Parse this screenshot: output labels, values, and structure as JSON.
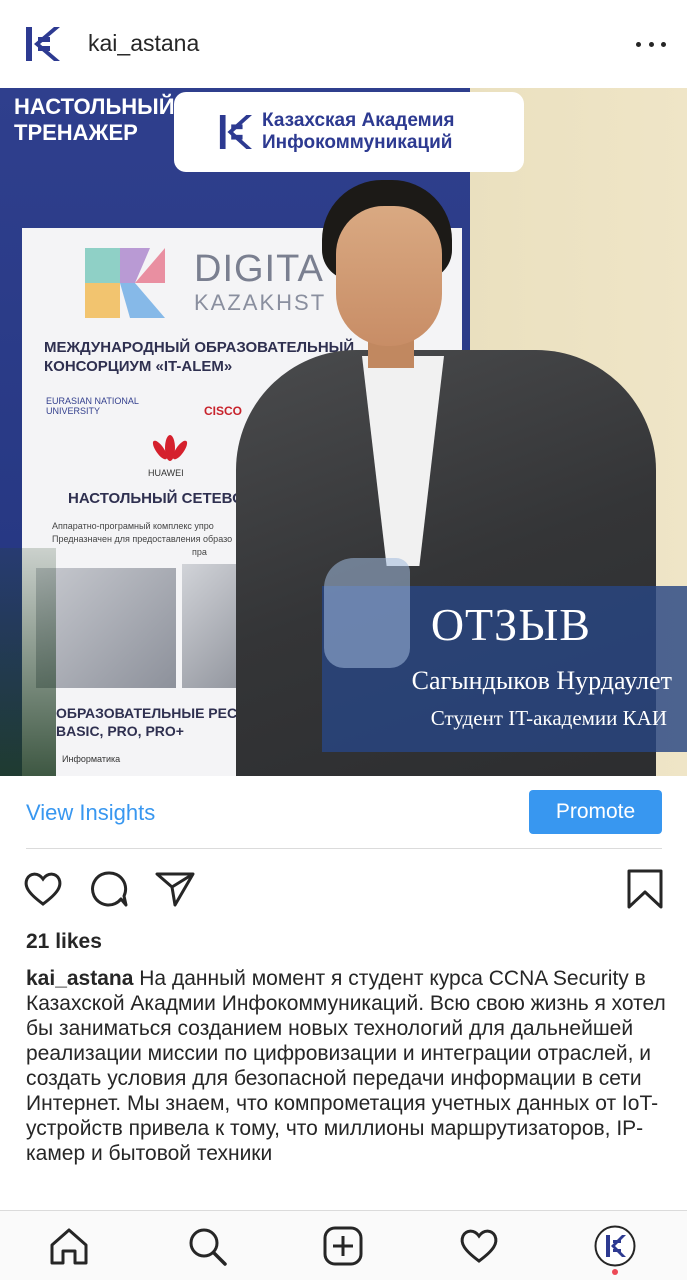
{
  "header": {
    "username": "kai_astana",
    "avatar_icon": "kai-logo-icon",
    "more_icon": "more-horizontal-icon"
  },
  "photo": {
    "banner_text": "НАСТОЛЬНЫЙ ТРЕНАЖЕР",
    "kai_badge_line1": "Казахская Академия",
    "kai_badge_line2": "Инфокоммуникаций",
    "poster": {
      "brand": "DIGITA",
      "brand_sub": "KAZAKHST",
      "heading1": "МЕЖДУНАРОДНЫЙ ОБРАЗОВАТЕЛЬНЫЙ КОНСОРЦИУМ «IT-ALEM»",
      "enu": "EURASIAN NATIONAL UNIVERSITY",
      "cisco": "CISCO",
      "huawei": "HUAWEI",
      "heading2": "НАСТОЛЬНЫЙ СЕТЕВОЙ ТР",
      "small1": "Аппаратно-програмный комплекс упро",
      "small2": "Предназначен для предоставления образо",
      "small3": "пра",
      "heading3": "ОБРАЗОВАТЕЛЬНЫЕ РЕСУРСЫ: BASIC, PRO, PRO+",
      "inf": "Информатика"
    },
    "review_title": "ОТЗЫВ",
    "review_name": "Сагындыков Нурдаулет",
    "review_subtitle": "Студент IT-академии КАИ"
  },
  "insights": {
    "view_insights_label": "View Insights",
    "promote_label": "Promote"
  },
  "actions": {
    "like_icon": "heart-icon",
    "comment_icon": "comment-icon",
    "share_icon": "send-icon",
    "save_icon": "bookmark-icon"
  },
  "likes_text": "21 likes",
  "caption": {
    "username": "kai_astana",
    "text": "На данный момент я студент курса CCNA Security в Казахской Акадмии Инфокоммуникаций.  Всю свою жизнь я хотел бы заниматься созданием новых технологий для дальнейшей реализации миссии по цифровизации и интеграции отраслей, и создать условия для безопасной передачи информации в сети Интернет. Мы знаем, что компрометация учетных данных от IoT-устройств привела к тому, что миллионы маршрутизаторов, IP-камер и бытовой техники"
  },
  "bottom_nav": {
    "home_icon": "home-icon",
    "search_icon": "search-icon",
    "add_icon": "add-post-icon",
    "activity_icon": "heart-icon",
    "profile_icon": "profile-avatar-icon"
  },
  "colors": {
    "accent": "#3897f0",
    "text": "#262626",
    "kai_blue": "#2d3a91",
    "notification_dot": "#ed4956"
  }
}
